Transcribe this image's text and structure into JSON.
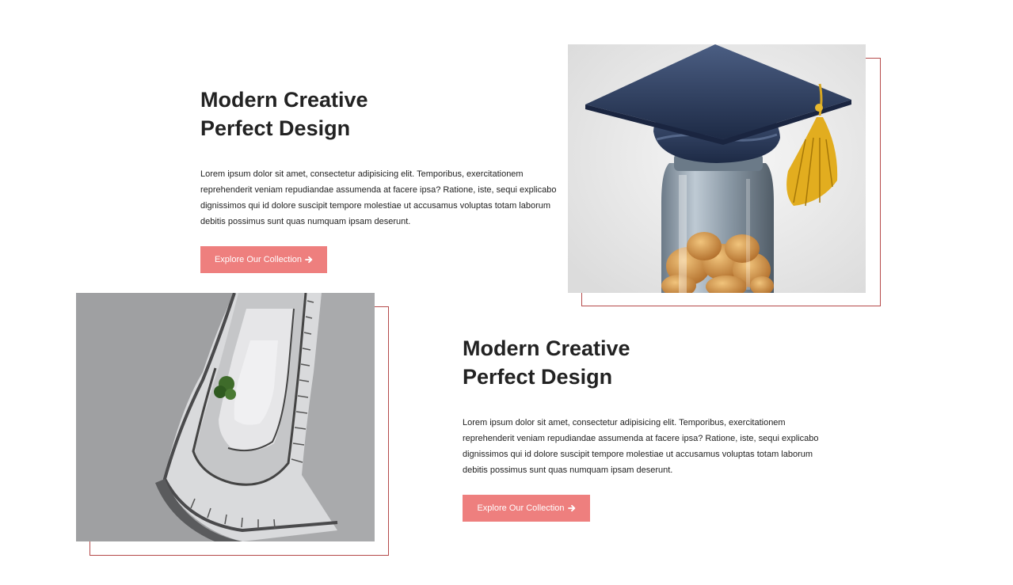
{
  "sections": [
    {
      "title_line1": "Modern Creative",
      "title_line2": "Perfect Design",
      "description": "Lorem ipsum dolor sit amet, consectetur adipisicing elit. Temporibus, exercitationem reprehenderit veniam repudiandae assumenda at facere ipsa? Ratione, iste, sequi explicabo dignissimos qui id dolore suscipit tempore molestiae ut accusamus voluptas totam laborum debitis possimus sunt quas numquam ipsam deserunt.",
      "button_label": "Explore Our Collection",
      "button_icon": "arrow-right-icon",
      "image": "graduation-cap-coin-jar"
    },
    {
      "title_line1": "Modern Creative",
      "title_line2": "Perfect Design",
      "description": "Lorem ipsum dolor sit amet, consectetur adipisicing elit. Temporibus, exercitationem reprehenderit veniam repudiandae assumenda at facere ipsa? Ratione, iste, sequi explicabo dignissimos qui id dolore suscipit tempore molestiae ut accusamus voluptas totam laborum debitis possimus sunt quas numquam ipsam deserunt.",
      "button_label": "Explore Our Collection",
      "button_icon": "arrow-right-icon",
      "image": "spiral-staircase"
    }
  ],
  "colors": {
    "accent": "#ee7f7e",
    "frame": "#b54a4a",
    "text": "#222222"
  }
}
